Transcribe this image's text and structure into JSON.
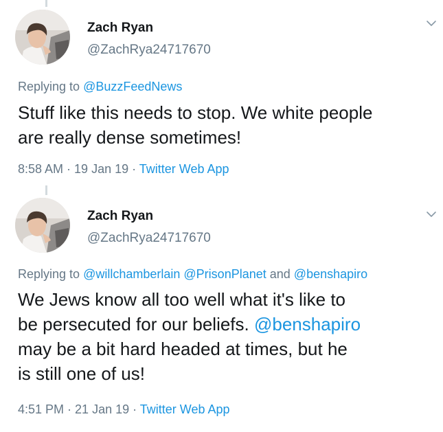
{
  "tweets": [
    {
      "author_name": "Zach Ryan",
      "author_handle": "@ZachRya24717670",
      "reply_prefix": "Replying to ",
      "reply_mentions": [
        "@BuzzFeedNews"
      ],
      "text_lines": [
        "Stuff like this needs to stop. We white people",
        "are really dense sometimes!"
      ],
      "time": "8:58 AM",
      "date": "19 Jan 19",
      "source": "Twitter Web App",
      "separator": " · "
    },
    {
      "author_name": "Zach Ryan",
      "author_handle": "@ZachRya24717670",
      "reply_prefix": "Replying to ",
      "reply_mention_1": "@willchamberlain",
      "reply_mention_2": "@PrisonPlanet",
      "reply_conjunction": " and ",
      "reply_mention_3": "@benshapiro",
      "text_line_1": "We Jews know all too well what it's like to",
      "text_line_2_plain": "be persecuted for our beliefs. ",
      "text_line_2_mention": "@benshapiro",
      "text_line_3": "may be a bit hard headed at times, but he",
      "text_line_4": "is still one of us!",
      "time": "4:51 PM",
      "date": "21 Jan 19",
      "source": "Twitter Web App",
      "separator": " · "
    }
  ],
  "icons": {
    "caret": "chevron-down-icon",
    "avatar": "avatar-photo"
  },
  "colors": {
    "link": "#1b95e0",
    "secondary_text": "#657786",
    "primary_text": "#14171a"
  }
}
